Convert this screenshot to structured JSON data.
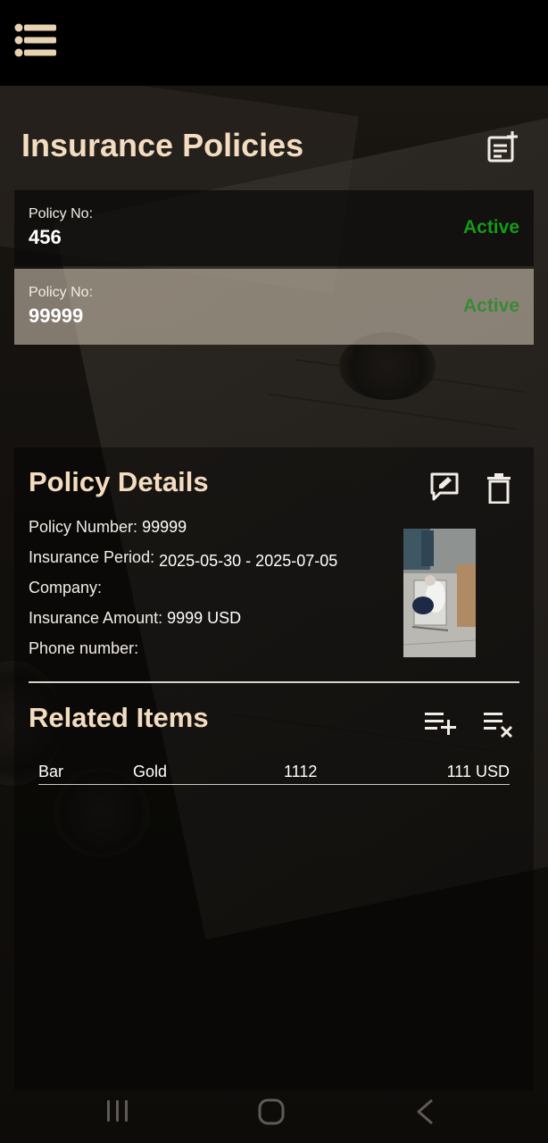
{
  "header": {
    "title": "Insurance Policies"
  },
  "policies": [
    {
      "label": "Policy No:",
      "number": "456",
      "status": "Active"
    },
    {
      "label": "Policy No:",
      "number": "99999",
      "status": "Active"
    }
  ],
  "details": {
    "title": "Policy Details",
    "policy_number_label": "Policy Number:",
    "policy_number_value": "99999",
    "period_label": "Insurance Period:",
    "period_value": "2025-05-30 - 2025-07-05",
    "company_label": "Company:",
    "company_value": "",
    "amount_label": "Insurance Amount:",
    "amount_value": "9999 USD",
    "phone_label": "Phone number:",
    "phone_value": ""
  },
  "related": {
    "title": "Related Items",
    "items": [
      {
        "name": "Bar",
        "material": "Gold",
        "code": "1112",
        "value": "111 USD"
      }
    ]
  },
  "icons": {
    "menu": "menu-list-icon",
    "add_policy": "note-add-icon",
    "edit": "edit-comment-icon",
    "delete": "trash-icon",
    "add_item": "playlist-add-icon",
    "clear_items": "playlist-remove-icon"
  },
  "colors": {
    "accent": "#f3dcc0",
    "status_active": "#159a1a",
    "topbar": "#000000"
  }
}
